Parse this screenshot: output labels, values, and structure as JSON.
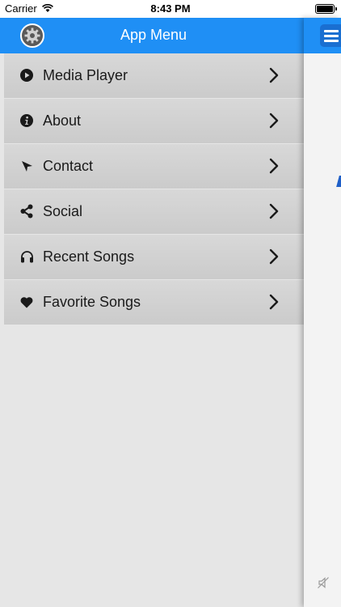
{
  "status_bar": {
    "carrier": "Carrier",
    "time": "8:43 PM"
  },
  "drawer": {
    "title": "App Menu",
    "settings_icon": "gear-icon",
    "items": [
      {
        "label": "Media Player",
        "icon": "play-circle-icon"
      },
      {
        "label": "About",
        "icon": "info-icon"
      },
      {
        "label": "Contact",
        "icon": "location-arrow-icon"
      },
      {
        "label": "Social",
        "icon": "share-icon"
      },
      {
        "label": "Recent Songs",
        "icon": "headphones-icon"
      },
      {
        "label": "Favorite Songs",
        "icon": "heart-icon"
      }
    ]
  },
  "colors": {
    "header": "#1f8ff5",
    "menu_item": "#d2d2d2",
    "drawer_bg": "#e6e6e6"
  }
}
